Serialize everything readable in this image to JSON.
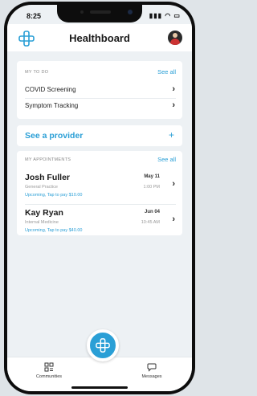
{
  "status": {
    "time": "8:25",
    "icons": "▮▮▮ ◠ ▭"
  },
  "header": {
    "title": "Healthboard"
  },
  "todo": {
    "label": "MY TO DO",
    "see_all": "See all",
    "items": [
      {
        "label": "COVID Screening"
      },
      {
        "label": "Symptom Tracking"
      }
    ]
  },
  "provider": {
    "label": "See a provider",
    "plus": "+"
  },
  "appointments": {
    "label": "MY APPOINTMENTS",
    "see_all": "See all",
    "items": [
      {
        "name": "Josh Fuller",
        "date": "May 11",
        "specialty": "General Practice",
        "time": "1:00 PM",
        "pay": "Upcoming, Tap to pay $10.00"
      },
      {
        "name": "Kay Ryan",
        "date": "Jun 04",
        "specialty": "Internal Medicine",
        "time": "10:45 AM",
        "pay": "Upcoming, Tap to pay $40.00"
      }
    ]
  },
  "tabs": {
    "communities": "Communities",
    "messages": "Messages"
  },
  "colors": {
    "accent": "#2a9fd6",
    "background": "#edf1f4"
  }
}
